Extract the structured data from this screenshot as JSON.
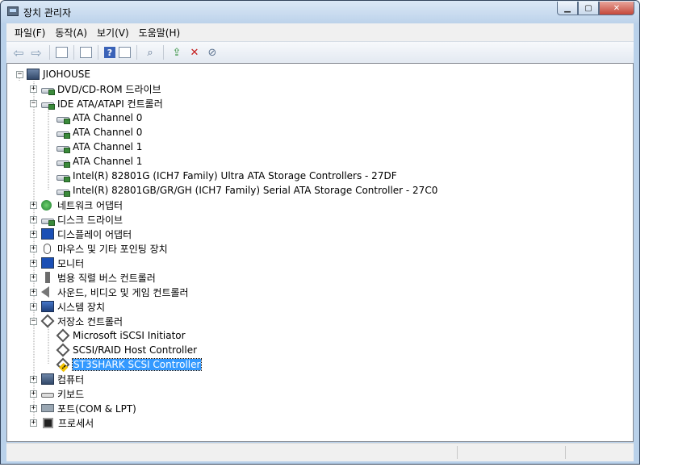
{
  "window": {
    "title": "장치 관리자"
  },
  "menu": [
    "파일(F)",
    "동작(A)",
    "보기(V)",
    "도움말(H)"
  ],
  "toolbar_icons": [
    "back-icon",
    "forward-icon",
    "up-icon",
    "properties-icon",
    "help-icon",
    "view-icon",
    "scan-icon",
    "update-driver-icon",
    "uninstall-icon",
    "disable-icon"
  ],
  "tree": {
    "root": "JIOHOUSE",
    "dvd": "DVD/CD-ROM 드라이브",
    "ide": "IDE ATA/ATAPI 컨트롤러",
    "ide_children": [
      "ATA Channel 0",
      "ATA Channel 0",
      "ATA Channel 1",
      "ATA Channel 1",
      "Intel(R) 82801G (ICH7 Family) Ultra ATA Storage Controllers - 27DF",
      "Intel(R) 82801GB/GR/GH (ICH7 Family) Serial ATA Storage Controller - 27C0"
    ],
    "network": "네트워크 어댑터",
    "disk": "디스크 드라이브",
    "display": "디스플레이 어댑터",
    "mouse": "마우스 및 기타 포인팅 장치",
    "monitor": "모니터",
    "usb": "범용 직렬 버스 컨트롤러",
    "sound": "사운드, 비디오 및 게임 컨트롤러",
    "system": "시스템 장치",
    "storage": "저장소 컨트롤러",
    "storage_children": [
      "Microsoft iSCSI Initiator",
      "SCSI/RAID Host Controller",
      "ST3SHARK SCSI Controller"
    ],
    "computer": "컴퓨터",
    "keyboard": "키보드",
    "ports": "포트(COM & LPT)",
    "processor": "프로세서"
  }
}
